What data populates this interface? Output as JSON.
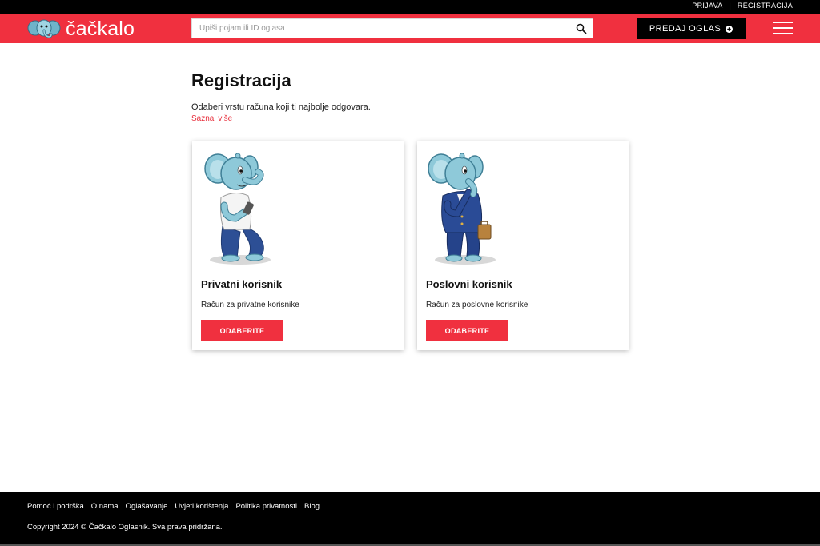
{
  "topbar": {
    "login": "PRIJAVA",
    "separator": "|",
    "register": "REGISTRACIJA"
  },
  "header": {
    "logo_text": "čačkalo",
    "search_placeholder": "Upiši pojam ili ID oglasa",
    "sell_button": "PREDAJ OGLAS",
    "icons": {
      "search": "search-icon",
      "sell": "plus-circle-icon",
      "menu": "hamburger-menu-icon",
      "logo": "elephant-logo-icon"
    }
  },
  "main": {
    "title": "Registracija",
    "intro": "Odaberi vrstu računa koji ti najbolje odgovara.",
    "more_link": "Saznaj više",
    "cards": [
      {
        "title": "Privatni korisnik",
        "description": "Račun za privatne korisnike",
        "button": "ODABERITE",
        "illustration": "elephant-casual-icon"
      },
      {
        "title": "Poslovni korisnik",
        "description": "Račun za poslovne korisnike",
        "button": "ODABERITE",
        "illustration": "elephant-business-icon"
      }
    ]
  },
  "footer": {
    "links": [
      "Pomoć i podrška",
      "O nama",
      "Oglašavanje",
      "Uvjeti korištenja",
      "Politika privatnosti",
      "Blog"
    ],
    "copyright": "Copyright 2024 © Čačkalo Oglasnik. Sva prava pridržana."
  },
  "colors": {
    "brand_red": "#f0303f",
    "black": "#000000",
    "elephant_blue": "#8ec9d9"
  }
}
